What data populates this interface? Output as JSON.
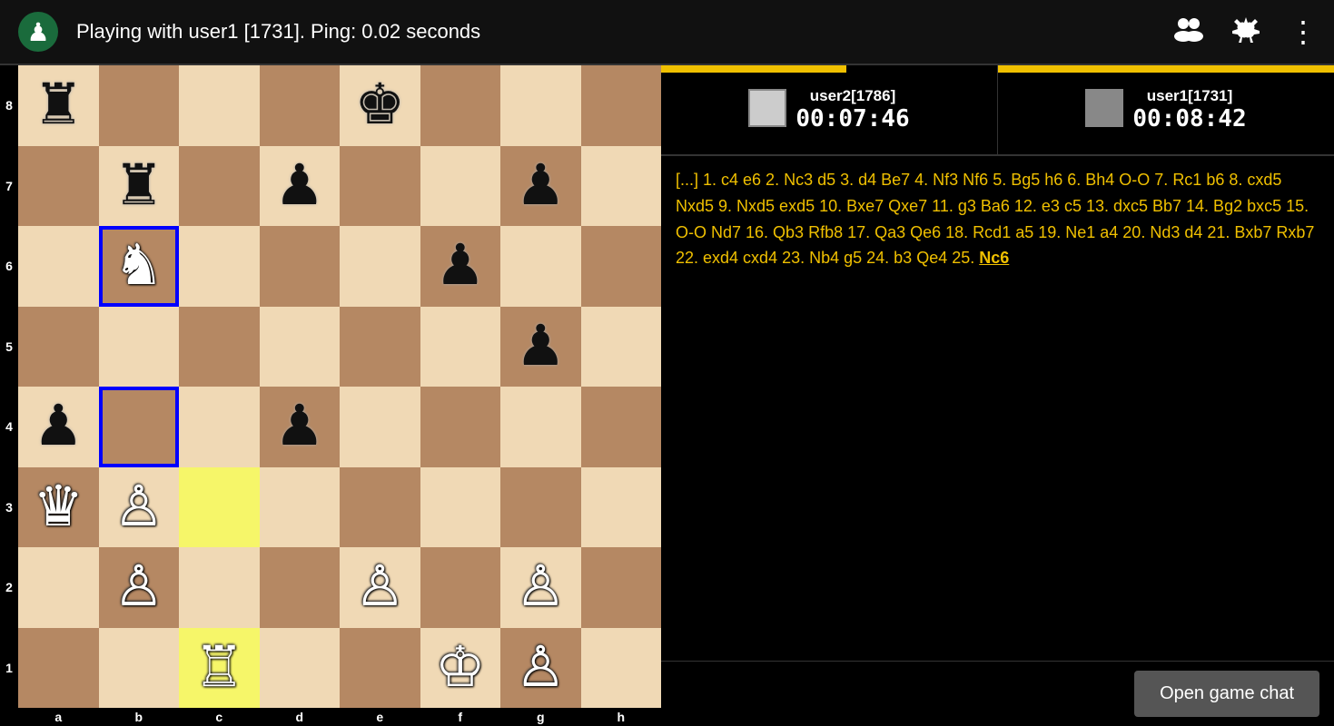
{
  "topbar": {
    "logo": "♟",
    "title": "Playing with user1 [1731]. Ping: 0.02 seconds",
    "icon_users": "👥",
    "icon_settings": "⚙",
    "icon_more": "⋮"
  },
  "players": {
    "left": {
      "name": "user2[1786]",
      "time": "00:07:46",
      "timer_bar_pct": "55%",
      "avatar_color": "#ccc"
    },
    "right": {
      "name": "user1[1731]",
      "time": "00:08:42",
      "timer_bar_pct": "100%",
      "avatar_color": "#888"
    }
  },
  "moves": {
    "text": "[...] 1. c4 e6 2. Nc3 d5 3. d4 Be7 4. Nf3 Nf6 5. Bg5 h6 6. Bh4 O-O 7. Rc1 b6 8. cxd5 Nxd5 9. Nxd5 exd5 10. Bxe7 Qxe7 11. g3 Ba6 12. e3 c5 13. dxc5 Bb7 14. Bg2 bxc5 15. O-O Nd7 16. Qb3 Rfb8 17. Qa3 Qe6 18. Rcd1 a5 19. Ne1 a4 20. Nd3 d4 21. Bxb7 Rxb7 22. exd4 cxd4 23. Nb4 g5 24. b3 Qe4 25.",
    "last_move": "Nc6"
  },
  "chat_button": {
    "label": "Open game chat"
  },
  "board": {
    "ranks": [
      "8",
      "7",
      "6",
      "5",
      "4",
      "3",
      "2",
      "1"
    ],
    "files": [
      "a",
      "b",
      "c",
      "d",
      "e",
      "f",
      "g",
      "h"
    ],
    "highlight_yellow": [
      "c3",
      "c1"
    ],
    "highlight_blue": [
      "b6",
      "b4"
    ],
    "pieces": {
      "a8": {
        "piece": "♜",
        "color": "black"
      },
      "e8": {
        "piece": "♚",
        "color": "black"
      },
      "b7": {
        "piece": "♜",
        "color": "black"
      },
      "d7": {
        "piece": "♟",
        "color": "black"
      },
      "g7": {
        "piece": "♟",
        "color": "black"
      },
      "b6": {
        "piece": "♞",
        "color": "white"
      },
      "f6": {
        "piece": "♟",
        "color": "black"
      },
      "g5": {
        "piece": "♟",
        "color": "black"
      },
      "a4": {
        "piece": "♟",
        "color": "black"
      },
      "d4": {
        "piece": "♟",
        "color": "black"
      },
      "b3": {
        "piece": "♙",
        "color": "white"
      },
      "a3": {
        "piece": "♛",
        "color": "white"
      },
      "b2": {
        "piece": "♙",
        "color": "white"
      },
      "e2": {
        "piece": "♙",
        "color": "white"
      },
      "g2": {
        "piece": "♙",
        "color": "white"
      },
      "c1": {
        "piece": "♖",
        "color": "white"
      },
      "f1": {
        "piece": "♔",
        "color": "white"
      },
      "g1": {
        "piece": "♙",
        "color": "white"
      }
    }
  }
}
